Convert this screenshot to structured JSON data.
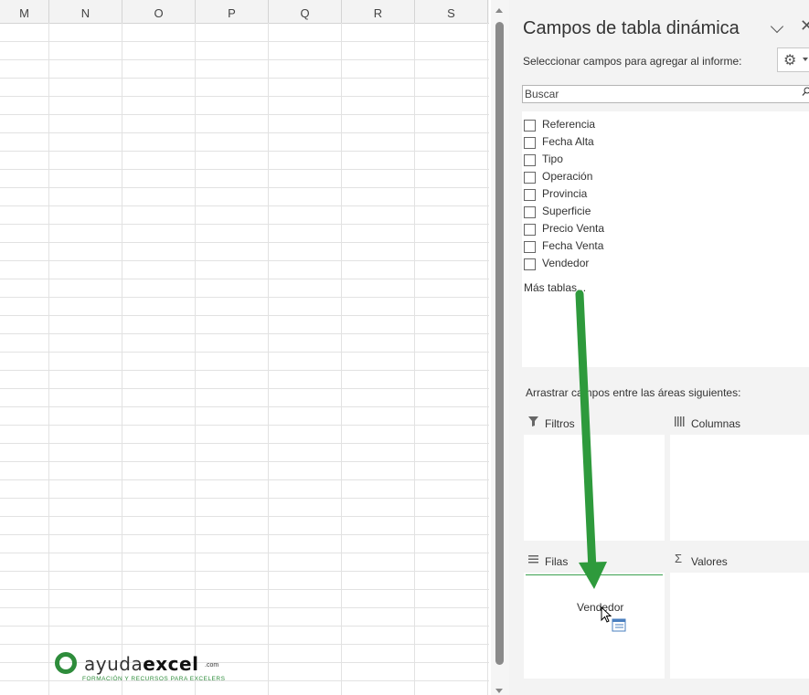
{
  "sheet": {
    "columns": [
      "M",
      "N",
      "O",
      "P",
      "Q",
      "R",
      "S"
    ]
  },
  "panel": {
    "title": "Campos de tabla dinámica",
    "subtitle": "Seleccionar campos para agregar al informe:",
    "search_placeholder": "Buscar",
    "fields": [
      "Referencia",
      "Fecha Alta",
      "Tipo",
      "Operación",
      "Provincia",
      "Superficie",
      "Precio Venta",
      "Fecha Venta",
      "Vendedor"
    ],
    "more_tables": "Más tablas...",
    "drag_hint": "Arrastrar campos entre las áreas siguientes:",
    "areas": {
      "filters": "Filtros",
      "columns": "Columnas",
      "rows": "Filas",
      "values": "Valores"
    },
    "dragging_item": "Vendedor"
  },
  "logo": {
    "brand_light": "ayuda",
    "brand_bold": "excel",
    "suffix": ".com",
    "tagline": "FORMACIÓN Y RECURSOS PARA EXCELERS"
  },
  "colors": {
    "arrow": "#2e9a3c",
    "accent": "#2e8c3b"
  },
  "icons": [
    "gear-icon",
    "search-icon",
    "chevron-down-icon",
    "close-icon",
    "filter-icon",
    "columns-icon",
    "rows-icon",
    "sigma-icon",
    "cursor-icon"
  ]
}
